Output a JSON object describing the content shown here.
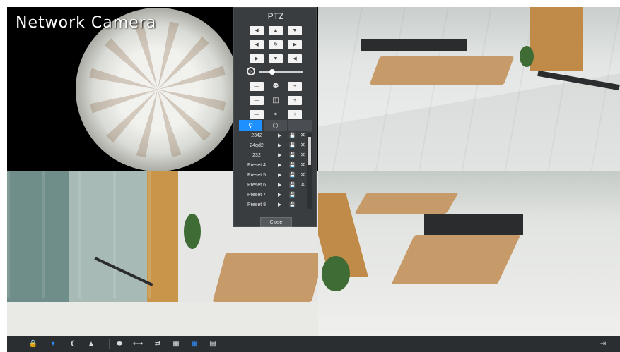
{
  "camera_title": "Network Camera",
  "ptz": {
    "title": "PTZ",
    "speed_fraction": 0.3,
    "tabs": [
      {
        "icon": "preset-pin-icon",
        "glyph": "⚲",
        "active": true
      },
      {
        "icon": "patrol-icon",
        "glyph": "⬡",
        "active": false
      },
      {
        "icon": "pattern-icon",
        "glyph": "",
        "active": false
      }
    ],
    "presets": [
      {
        "name": "2342",
        "deletable": true
      },
      {
        "name": "24qd2",
        "deletable": true
      },
      {
        "name": "232",
        "deletable": true
      },
      {
        "name": "Preset 4",
        "deletable": true
      },
      {
        "name": "Preset 5",
        "deletable": true
      },
      {
        "name": "Preset 6",
        "deletable": true
      },
      {
        "name": "Preset 7",
        "deletable": false
      },
      {
        "name": "Preset 8",
        "deletable": false
      }
    ],
    "close_label": "Close"
  },
  "icons": {
    "up_left": "▲",
    "up": "▲",
    "up_right": "▼",
    "left": "◀",
    "auto": "↻",
    "right": "▶",
    "down_left": "▶",
    "down": "▼",
    "down_right": "◀",
    "minus": "—",
    "plus": "+",
    "zoom": "⚉",
    "focus": "◫",
    "iris": "⚬",
    "call": "▶",
    "save": "💾",
    "delete": "✕"
  },
  "toolbar": {
    "left_icons": [
      {
        "name": "lock-icon",
        "glyph": "🔒",
        "active": false
      },
      {
        "name": "fisheye-ceiling-icon",
        "glyph": "▾",
        "active": true
      },
      {
        "name": "fisheye-wall-icon",
        "glyph": "❨",
        "active": false
      },
      {
        "name": "fisheye-desktop-icon",
        "glyph": "▲",
        "active": false
      },
      {
        "name": "circle-view-icon",
        "glyph": "⬬",
        "active": false
      },
      {
        "name": "panorama-icon",
        "glyph": "⟷",
        "active": false
      },
      {
        "name": "double-panorama-icon",
        "glyph": "⇄",
        "active": false
      },
      {
        "name": "quad-view-icon",
        "glyph": "▦",
        "active": false
      },
      {
        "name": "fisheye-plus-3-icon",
        "glyph": "▦",
        "active": true
      },
      {
        "name": "fisheye-plus-8-icon",
        "glyph": "▤",
        "active": false
      }
    ],
    "exit_glyph": "⇥"
  }
}
